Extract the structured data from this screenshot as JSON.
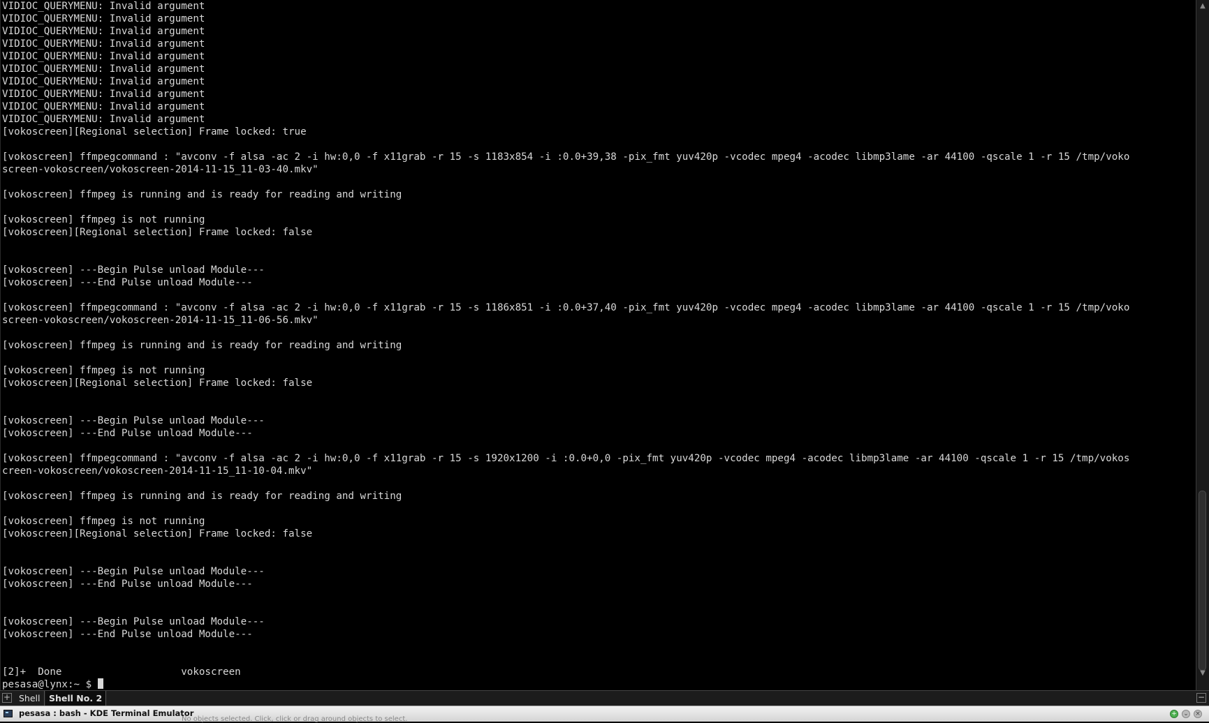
{
  "terminal": {
    "lines": [
      "VIDIOC_QUERYMENU: Invalid argument",
      "VIDIOC_QUERYMENU: Invalid argument",
      "VIDIOC_QUERYMENU: Invalid argument",
      "VIDIOC_QUERYMENU: Invalid argument",
      "VIDIOC_QUERYMENU: Invalid argument",
      "VIDIOC_QUERYMENU: Invalid argument",
      "VIDIOC_QUERYMENU: Invalid argument",
      "VIDIOC_QUERYMENU: Invalid argument",
      "VIDIOC_QUERYMENU: Invalid argument",
      "VIDIOC_QUERYMENU: Invalid argument",
      "[vokoscreen][Regional selection] Frame locked: true",
      "",
      "[vokoscreen] ffmpegcommand : \"avconv -f alsa -ac 2 -i hw:0,0 -f x11grab -r 15 -s 1183x854 -i :0.0+39,38 -pix_fmt yuv420p -vcodec mpeg4 -acodec libmp3lame -ar 44100 -qscale 1 -r 15 /tmp/voko",
      "screen-vokoscreen/vokoscreen-2014-11-15_11-03-40.mkv\"",
      "",
      "[vokoscreen] ffmpeg is running and is ready for reading and writing",
      "",
      "[vokoscreen] ffmpeg is not running",
      "[vokoscreen][Regional selection] Frame locked: false",
      "",
      "",
      "[vokoscreen] ---Begin Pulse unload Module---",
      "[vokoscreen] ---End Pulse unload Module---",
      "",
      "[vokoscreen] ffmpegcommand : \"avconv -f alsa -ac 2 -i hw:0,0 -f x11grab -r 15 -s 1186x851 -i :0.0+37,40 -pix_fmt yuv420p -vcodec mpeg4 -acodec libmp3lame -ar 44100 -qscale 1 -r 15 /tmp/voko",
      "screen-vokoscreen/vokoscreen-2014-11-15_11-06-56.mkv\"",
      "",
      "[vokoscreen] ffmpeg is running and is ready for reading and writing",
      "",
      "[vokoscreen] ffmpeg is not running",
      "[vokoscreen][Regional selection] Frame locked: false",
      "",
      "",
      "[vokoscreen] ---Begin Pulse unload Module---",
      "[vokoscreen] ---End Pulse unload Module---",
      "",
      "[vokoscreen] ffmpegcommand : \"avconv -f alsa -ac 2 -i hw:0,0 -f x11grab -r 15 -s 1920x1200 -i :0.0+0,0 -pix_fmt yuv420p -vcodec mpeg4 -acodec libmp3lame -ar 44100 -qscale 1 -r 15 /tmp/vokos",
      "creen-vokoscreen/vokoscreen-2014-11-15_11-10-04.mkv\"",
      "",
      "[vokoscreen] ffmpeg is running and is ready for reading and writing",
      "",
      "[vokoscreen] ffmpeg is not running",
      "[vokoscreen][Regional selection] Frame locked: false",
      "",
      "",
      "[vokoscreen] ---Begin Pulse unload Module---",
      "[vokoscreen] ---End Pulse unload Module---",
      "",
      "",
      "[vokoscreen] ---Begin Pulse unload Module---",
      "[vokoscreen] ---End Pulse unload Module---",
      "",
      "",
      "[2]+  Done                    vokoscreen"
    ],
    "prompt": "pesasa@lynx:~ $ "
  },
  "scrollbar": {
    "up_arrow": "▲",
    "down_arrow": "▼"
  },
  "tabs": {
    "new_tab_icon": "+",
    "items": [
      {
        "label": "Shell"
      },
      {
        "label": "Shell No. 2"
      }
    ],
    "close_icon": "−"
  },
  "taskbar": {
    "window_title": "pesasa : bash - KDE Terminal Emulator",
    "status_text": "No objects selected. Click, click or drag around objects to select.",
    "tray_add": "+",
    "tray_down": "⌄",
    "tray_close": "×"
  },
  "colors": {
    "terminal_bg": "#000000",
    "terminal_fg": "#d8d8d8"
  }
}
